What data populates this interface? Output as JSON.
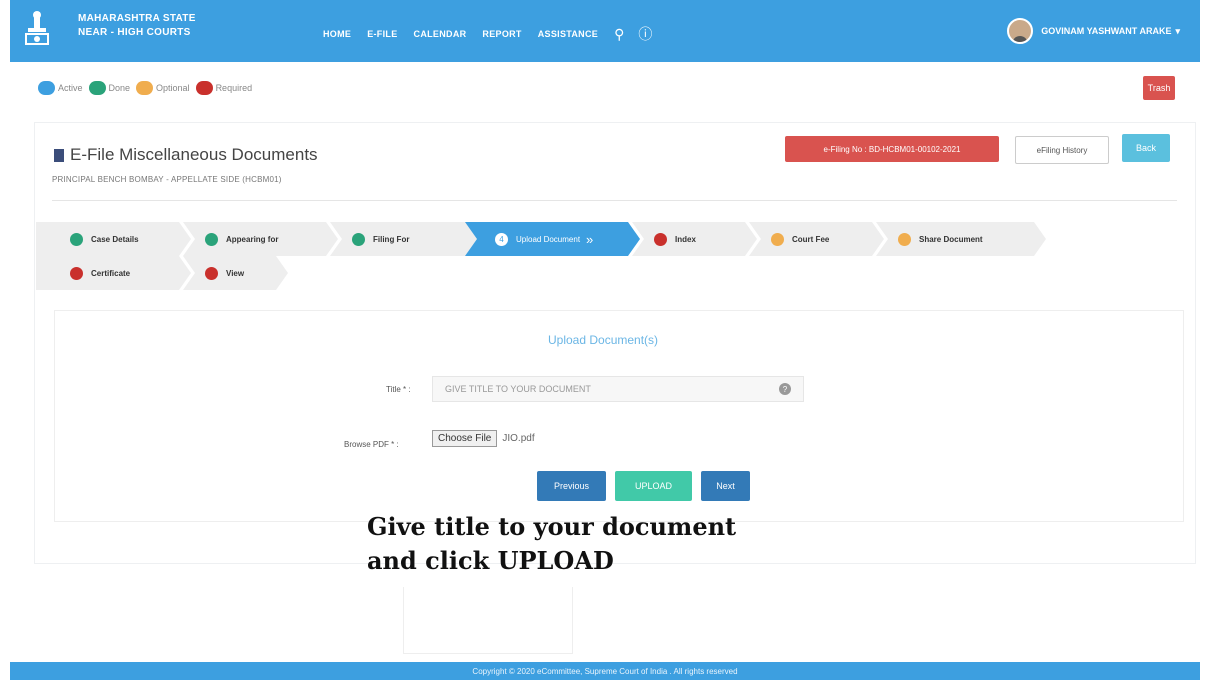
{
  "header": {
    "brand_line1": "MAHARASHTRA STATE",
    "brand_line2": "NEAR - HIGH COURTS",
    "nav": [
      "HOME",
      "E-FILE",
      "CALENDAR",
      "REPORT",
      "ASSISTANCE"
    ],
    "user_name": "GOVINAM YASHWANT ARAKE"
  },
  "legend": [
    {
      "label": "Active",
      "color": "#3d9fe0"
    },
    {
      "label": "Done",
      "color": "#2aa37a"
    },
    {
      "label": "Optional",
      "color": "#f0ad4e"
    },
    {
      "label": "Required",
      "color": "#c9302c"
    }
  ],
  "trash_label": "Trash",
  "page": {
    "title": "E-File Miscellaneous Documents",
    "subtitle": "PRINCIPAL BENCH BOMBAY - APPELLATE SIDE (HCBM01)",
    "efiling_no": "e-Filing No : BD-HCBM01-00102-2021",
    "history_label": "eFiling History",
    "back_label": "Back"
  },
  "steps": [
    {
      "label": "Case Details",
      "num": "",
      "color": "#2aa37a"
    },
    {
      "label": "Appearing for",
      "num": "",
      "color": "#2aa37a"
    },
    {
      "label": "Filing For",
      "num": "",
      "color": "#2aa37a"
    },
    {
      "label": "Upload Document",
      "num": "4",
      "color": "#ffffff"
    },
    {
      "label": "Index",
      "num": "",
      "color": "#c9302c"
    },
    {
      "label": "Court Fee",
      "num": "",
      "color": "#f0ad4e"
    },
    {
      "label": "Share Document",
      "num": "",
      "color": "#f0ad4e"
    },
    {
      "label": "Certificate",
      "num": "",
      "color": "#c9302c"
    },
    {
      "label": "View",
      "num": "",
      "color": "#c9302c"
    }
  ],
  "upload": {
    "heading": "Upload Document(s)",
    "title_label": "Title * :",
    "title_placeholder": "GIVE TITLE TO YOUR DOCUMENT",
    "browse_label": "Browse PDF * :",
    "choose_file": "Choose File",
    "file_name": "JIO.pdf",
    "previous": "Previous",
    "upload": "UPLOAD",
    "next": "Next"
  },
  "caption_line1": "Give title to your document",
  "caption_line2": "and click UPLOAD",
  "footer": "Copyright © 2020 eCommittee, Supreme Court of India . All rights reserved"
}
